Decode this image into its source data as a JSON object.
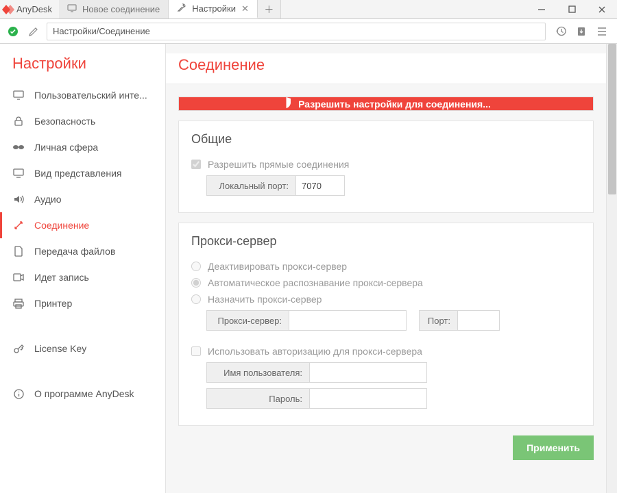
{
  "app_name": "AnyDesk",
  "tabs": {
    "new_connection": "Новое соединение",
    "settings": "Настройки"
  },
  "address_bar": "Настройки/Соединение",
  "sidebar": {
    "title": "Настройки",
    "items": {
      "ui": "Пользовательский инте...",
      "security": "Безопасность",
      "privacy": "Личная сфера",
      "display": "Вид представления",
      "audio": "Аудио",
      "connection": "Соединение",
      "file_transfer": "Передача файлов",
      "recording": "Идет запись",
      "printer": "Принтер",
      "license": "License Key",
      "about": "О программе AnyDesk"
    }
  },
  "content": {
    "title": "Соединение",
    "allow_bar": "Разрешить настройки для соединения...",
    "general": {
      "heading": "Общие",
      "allow_direct": "Разрешить прямые соединения",
      "local_port_label": "Локальный порт:",
      "local_port_value": "7070"
    },
    "proxy": {
      "heading": "Прокси-сервер",
      "disable": "Деактивировать прокси-сервер",
      "auto": "Автоматическое распознавание прокси-сервера",
      "manual": "Назначить прокси-сервер",
      "server_label": "Прокси-сервер:",
      "server_value": "",
      "port_label": "Порт:",
      "port_value": "",
      "use_auth": "Использовать авторизацию для прокси-сервера",
      "user_label": "Имя пользователя:",
      "user_value": "",
      "pass_label": "Пароль:",
      "pass_value": ""
    },
    "apply": "Применить"
  }
}
